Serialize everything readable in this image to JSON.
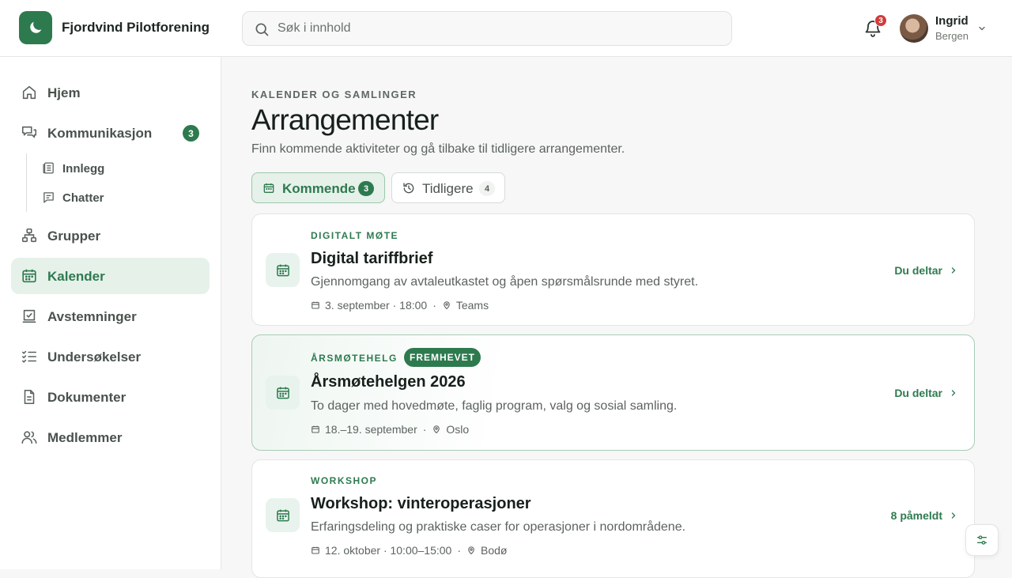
{
  "app": {
    "brand": "Fjordvind Pilotforening",
    "accent": "#2e7a4f"
  },
  "search": {
    "placeholder": "Søk i innhold",
    "value": ""
  },
  "notifications": {
    "count": "3"
  },
  "user": {
    "name": "Ingrid",
    "location": "Bergen"
  },
  "sidebar": {
    "items": [
      {
        "label": "Hjem",
        "icon": "home-icon"
      },
      {
        "label": "Kommunikasjon",
        "icon": "chat-icon",
        "badge": "3"
      },
      {
        "label": "Grupper",
        "icon": "groups-icon"
      },
      {
        "label": "Kalender",
        "icon": "calendar-icon",
        "active": true
      },
      {
        "label": "Avstemninger",
        "icon": "vote-icon"
      },
      {
        "label": "Undersøkelser",
        "icon": "survey-icon"
      },
      {
        "label": "Dokumenter",
        "icon": "document-icon"
      },
      {
        "label": "Medlemmer",
        "icon": "members-icon"
      }
    ],
    "subitems": [
      {
        "label": "Innlegg",
        "icon": "posts-icon"
      },
      {
        "label": "Chatter",
        "icon": "chats-icon"
      }
    ]
  },
  "page": {
    "eyebrow": "KALENDER OG SAMLINGER",
    "title": "Arrangementer",
    "subtitle": "Finn kommende aktiviteter og gå tilbake til tidligere arrangementer."
  },
  "tabs": [
    {
      "label": "Kommende",
      "count": "3",
      "active": true
    },
    {
      "label": "Tidligere",
      "count": "4"
    }
  ],
  "events": [
    {
      "category": "DIGITALT MØTE",
      "title": "Digital tariffbrief",
      "description": "Gjennomgang av avtaleutkastet og åpen spørsmålsrunde med styret.",
      "date": "3. september · 18:00",
      "location": "Teams",
      "action": "Du deltar"
    },
    {
      "category": "ÅRSMØTEHELG",
      "badge": "FREMHEVET",
      "title": "Årsmøtehelgen 2026",
      "description": "To dager med hovedmøte, faglig program, valg og sosial samling.",
      "date": "18.–19. september",
      "location": "Oslo",
      "action": "Du deltar"
    },
    {
      "category": "WORKSHOP",
      "title": "Workshop: vinteroperasjoner",
      "description": "Erfaringsdeling og praktiske caser for operasjoner i nordområdene.",
      "date": "12. oktober · 10:00–15:00",
      "location": "Bodø",
      "action": "8 påmeldt"
    }
  ]
}
